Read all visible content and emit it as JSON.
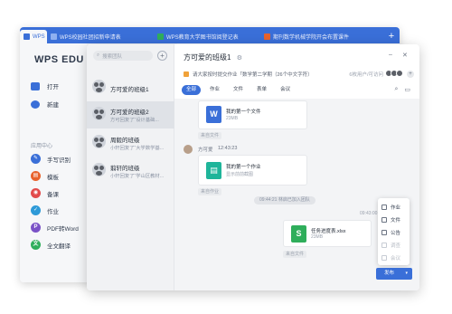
{
  "tabs": [
    {
      "label": "WPS",
      "color": "#3a6fd8"
    },
    {
      "label": "WPS校园社团招新申请表",
      "color": "#3a6fd8"
    },
    {
      "label": "WPS教育大学图书馆阅登记表",
      "color": "#2fae5b"
    },
    {
      "label": "期刊数学机械学院开会布置课件",
      "color": "#e8622c"
    }
  ],
  "back_sidebar": {
    "brand": "WPS EDU",
    "nav": [
      {
        "label": "打开",
        "icon": "folder-icon",
        "color": "#3a6fd8"
      },
      {
        "label": "新建",
        "icon": "new-doc-icon",
        "color": "#3a6fd8"
      }
    ],
    "section_title": "应用中心",
    "apps": [
      {
        "label": "手写识别",
        "icon": "handwriting-icon",
        "color": "#3a6fd8",
        "glyph": "✎"
      },
      {
        "label": "模板",
        "icon": "template-icon",
        "color": "#e8622c",
        "glyph": "▤"
      },
      {
        "label": "备课",
        "icon": "lesson-prep-icon",
        "color": "#e24b4b",
        "glyph": "◉"
      },
      {
        "label": "作业",
        "icon": "homework-icon",
        "color": "#2e9ad8",
        "glyph": "✓"
      },
      {
        "label": "PDF转Word",
        "icon": "pdf-to-word-icon",
        "color": "#7a52c7",
        "glyph": "P"
      },
      {
        "label": "全文翻译",
        "icon": "translate-icon",
        "color": "#2fae5b",
        "glyph": "文"
      }
    ]
  },
  "front": {
    "search_placeholder": "搜索团队",
    "classes": [
      {
        "name": "方可爱的班级1",
        "msg": ""
      },
      {
        "name": "方可爱的班级2",
        "msg": "方可回复了“设计基础..."
      },
      {
        "name": "周毅的班级",
        "msg": "小轩回复了“大学数学基..."
      },
      {
        "name": "翦轩的班级",
        "msg": "小轩回复了“学山区教材..."
      }
    ],
    "chat_title": "方可爱的班级1",
    "notice": "请大家按时提交作业「数学第二学期（26个中文字符）",
    "notice_right": "6枚用户/可访问",
    "chips": [
      "全部",
      "作业",
      "文件",
      "表单",
      "会议"
    ],
    "messages": {
      "file1_title": "我的第一个文件",
      "file1_size": "23MB",
      "file1_source": "来自文件",
      "sender": "方可爱",
      "sender_time": "12:43:23",
      "hw_title": "我的第一个作业",
      "hw_sub": "显示前前截图",
      "hw_source": "来自作业",
      "system_note": "09:44:21 林启已加入团队",
      "time_right": "09:43:00",
      "task_title": "任务进度表.xlsx",
      "task_size": "23MB",
      "task_source": "来自文件"
    },
    "popup": [
      {
        "label": "作业",
        "dim": false
      },
      {
        "label": "文件",
        "dim": false
      },
      {
        "label": "公告",
        "dim": false
      },
      {
        "label": "调查",
        "dim": true
      },
      {
        "label": "会议",
        "dim": true
      }
    ],
    "send_label": "发布"
  },
  "colors": {
    "accent": "#3a6fd8",
    "doc": "#3a6fd8",
    "sheet": "#2fae5b",
    "hw": "#1fb59a"
  }
}
